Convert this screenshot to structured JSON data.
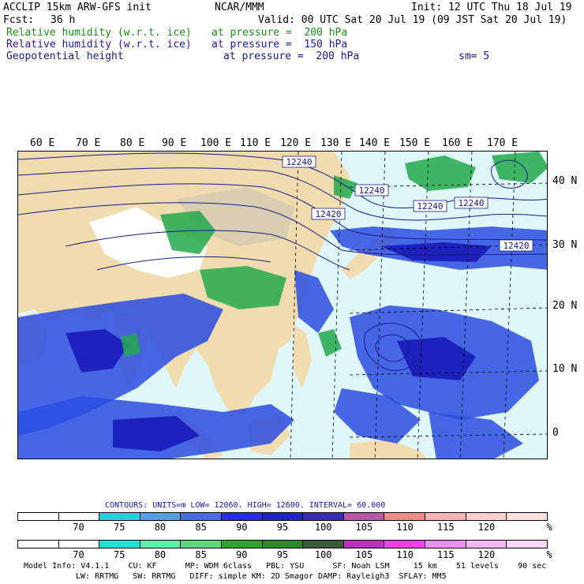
{
  "header": {
    "left_line1": "ACCLIP 15km ARW-GFS init",
    "center_line1": "NCAR/MMM",
    "right_line1": "Init: 12 UTC Thu 18 Jul 19",
    "fcst_label": "Fcst:",
    "fcst_value": "36 h",
    "valid": "Valid: 00 UTC Sat 20 Jul 19 (09 JST Sat 20 Jul 19)"
  },
  "fields": [
    {
      "name": "Relative humidity (w.r.t. ice)",
      "level": "at pressure =  200 hPa",
      "color": "#1a8f1a"
    },
    {
      "name": "Relative humidity (w.r.t. ice)",
      "level": "at pressure =  150 hPa",
      "color": "#1a1aa8"
    },
    {
      "name": "Geopotential height",
      "level": "at pressure =  200 hPa",
      "color": "#1a1a8a"
    }
  ],
  "smoothing": "sm= 5",
  "map": {
    "lon_labels": [
      "60 E",
      "70 E",
      "80 E",
      "90 E",
      "100 E",
      "110 E",
      "120 E",
      "130 E",
      "140 E",
      "150 E",
      "160 E",
      "170 E"
    ],
    "lat_labels": [
      "40 N",
      "30 N",
      "20 N",
      "10 N",
      "0"
    ],
    "contour_labels": [
      "12240",
      "12240",
      "12420",
      "12240",
      "12240",
      "12420"
    ],
    "colors": {
      "land": "#f0dcae",
      "ocean": "#dff7fb",
      "plateau": "#ffffff",
      "desert": "#d9cdb2",
      "contour": "#1a1a8a",
      "rh_green": "#22a84a",
      "rh_blue": "#2a4ee0",
      "rh_blue_dark": "#1a1ab8"
    }
  },
  "contours_info": {
    "text": "CONTOURS:  UNITS=m  LOW=   12060.     HIGH=  12600.     INTERVAL=    60.000"
  },
  "scale1": {
    "colors": [
      "#ffffff",
      "#ffffff",
      "#22d0e0",
      "#5a9cf0",
      "#4a6cf0",
      "#2a2aee",
      "#2222cc",
      "#3a2ab8",
      "#b85aa8",
      "#f08a8a",
      "#f4b4b4",
      "#f8d0d0",
      "#fae0e0"
    ],
    "ticks": [
      "70",
      "75",
      "80",
      "85",
      "90",
      "95",
      "100",
      "105",
      "110",
      "115",
      "120",
      "%"
    ]
  },
  "scale2": {
    "colors": [
      "#ffffff",
      "#ffffff",
      "#22e0d8",
      "#5af0a8",
      "#5ad880",
      "#2aa82a",
      "#2a8a2a",
      "#3a5a3a",
      "#c030c0",
      "#f040f0",
      "#f090f0",
      "#f4b8f4",
      "#f8d8f8"
    ],
    "ticks": [
      "70",
      "75",
      "80",
      "85",
      "90",
      "95",
      "100",
      "105",
      "110",
      "115",
      "120",
      "%"
    ]
  },
  "footer": {
    "line1": "Model Info: V4.1.1    CU: KF      MP: WDM 6class   PBL: YSU      SF: Noah LSM     15 km    51 levels    90 sec",
    "line2": "LW: RRTMG   SW: RRTMG   DIFF: simple KM: 2D Smagor DAMP: Rayleigh3  SFLAY: MM5"
  }
}
